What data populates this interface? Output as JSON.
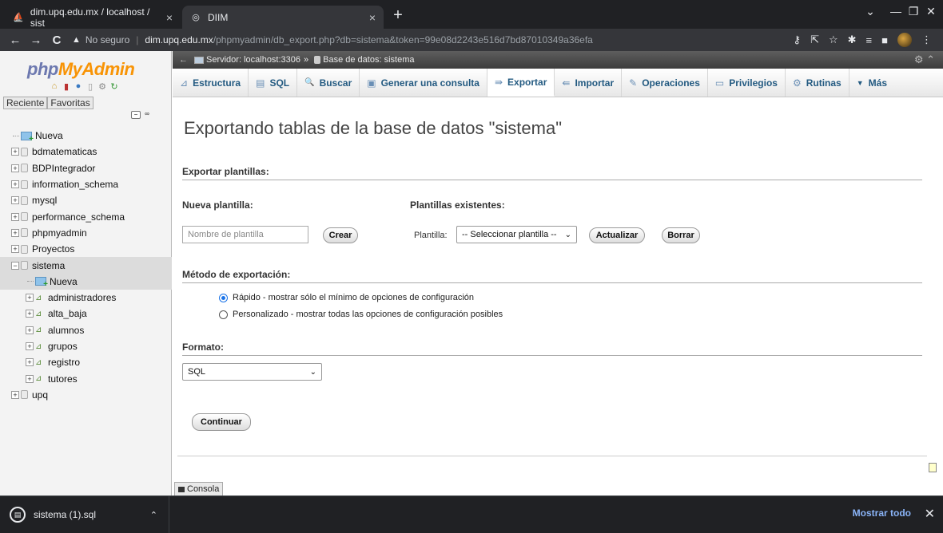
{
  "browser": {
    "tabs": [
      {
        "title": "dim.upq.edu.mx / localhost / sist",
        "close": "×"
      },
      {
        "title": "DIIM",
        "close": "×"
      }
    ],
    "new_tab": "+",
    "window_controls": {
      "minimize": "—",
      "maximize": "❐",
      "close": "✕",
      "dropdown": "⌄"
    },
    "nav": {
      "back": "←",
      "forward": "→",
      "reload": "C",
      "home": "⌂"
    },
    "address": {
      "security_label": "No seguro",
      "host": "dim.upq.edu.mx",
      "path": "/phpmyadmin/db_export.php?db=sistema&token=99e08d2243e516d7bd87010349a36efa"
    }
  },
  "sidebar": {
    "logo": {
      "php": "php",
      "my": "My",
      "admin": "Admin"
    },
    "tabs": {
      "recent": "Reciente",
      "favorites": "Favoritas"
    },
    "tree": [
      {
        "label": "Nueva",
        "type": "new",
        "level": 0
      },
      {
        "label": "bdmatematicas",
        "type": "db",
        "level": 0
      },
      {
        "label": "BDPIntegrador",
        "type": "db",
        "level": 0
      },
      {
        "label": "information_schema",
        "type": "db",
        "level": 0
      },
      {
        "label": "mysql",
        "type": "db",
        "level": 0
      },
      {
        "label": "performance_schema",
        "type": "db",
        "level": 0
      },
      {
        "label": "phpmyadmin",
        "type": "db",
        "level": 0
      },
      {
        "label": "Proyectos",
        "type": "db",
        "level": 0
      },
      {
        "label": "sistema",
        "type": "db-open",
        "level": 0
      },
      {
        "label": "Nueva",
        "type": "new",
        "level": 1
      },
      {
        "label": "administradores",
        "type": "table",
        "level": 1
      },
      {
        "label": "alta_baja",
        "type": "table",
        "level": 1
      },
      {
        "label": "alumnos",
        "type": "table",
        "level": 1
      },
      {
        "label": "grupos",
        "type": "table",
        "level": 1
      },
      {
        "label": "registro",
        "type": "table",
        "level": 1
      },
      {
        "label": "tutores",
        "type": "table",
        "level": 1
      },
      {
        "label": "upq",
        "type": "db",
        "level": 0
      }
    ]
  },
  "breadcrumb": {
    "server": "Servidor: localhost:3306",
    "separator": "»",
    "database": "Base de datos: sistema"
  },
  "topmenu": [
    {
      "label": "Estructura",
      "icon": "⊿"
    },
    {
      "label": "SQL",
      "icon": "▤"
    },
    {
      "label": "Buscar",
      "icon": "🔍"
    },
    {
      "label": "Generar una consulta",
      "icon": "▣"
    },
    {
      "label": "Exportar",
      "icon": "⇛",
      "active": true
    },
    {
      "label": "Importar",
      "icon": "⇚"
    },
    {
      "label": "Operaciones",
      "icon": "✎"
    },
    {
      "label": "Privilegios",
      "icon": "▭"
    },
    {
      "label": "Rutinas",
      "icon": "⚙"
    },
    {
      "label": "Más",
      "icon": "▼"
    }
  ],
  "content": {
    "title": "Exportando tablas de la base de datos \"sistema\"",
    "templates_header": "Exportar plantillas:",
    "new_template_label": "Nueva plantilla:",
    "new_template_placeholder": "Nombre de plantilla",
    "create_button": "Crear",
    "existing_templates_label": "Plantillas existentes:",
    "template_label": "Plantilla:",
    "template_select_value": "-- Seleccionar plantilla --",
    "update_button": "Actualizar",
    "delete_button": "Borrar",
    "method_header": "Método de exportación:",
    "method_options": [
      {
        "label": "Rápido - mostrar sólo el mínimo de opciones de configuración",
        "checked": true
      },
      {
        "label": "Personalizado - mostrar todas las opciones de configuración posibles",
        "checked": false
      }
    ],
    "format_header": "Formato:",
    "format_value": "SQL",
    "continue_button": "Continuar"
  },
  "console_tab": "Consola",
  "downloads": {
    "file": "sistema (1).sql",
    "show_all": "Mostrar todo",
    "close": "✕"
  }
}
